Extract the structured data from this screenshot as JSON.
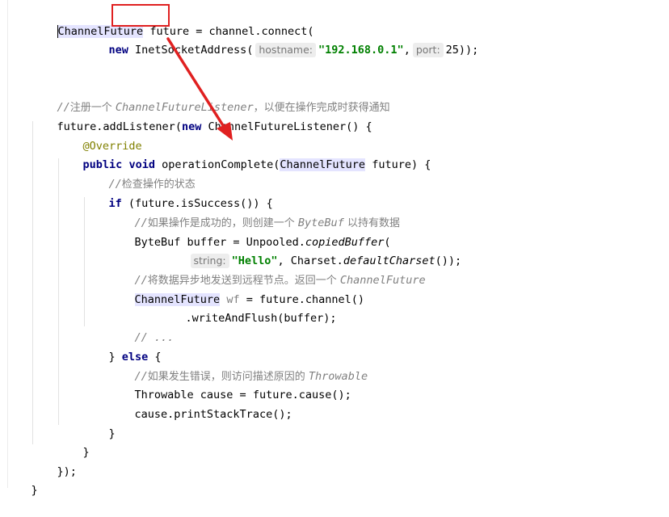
{
  "code": {
    "l1": {
      "type": "ChannelFuture",
      "var": "future",
      "rest": " = channel.connect("
    },
    "l2": {
      "kw_new": "new",
      "cls": "InetSocketAddress(",
      "hint1": "hostname:",
      "str1": "\"192.168.0.1\"",
      "sep": ",",
      "hint2": "port:",
      "rest": "25));"
    },
    "l3": {
      "slashes": "//",
      "zh1": "注册一个 ",
      "cls": "ChannelFutureListener",
      "zh2": "，以便在操作完成时获得通知"
    },
    "l4": {
      "pre": "future.addListener(",
      "kw_new": "new",
      "rest": " ChannelFutureListener() {"
    },
    "l5": {
      "ann": "@Override"
    },
    "l6": {
      "kw_public": "public",
      "kw_void": "void",
      "method": " operationComplete(",
      "type": "ChannelFuture",
      "rest": " future) {"
    },
    "l7": {
      "slashes": "//",
      "zh": "检查操作的状态"
    },
    "l8": {
      "kw_if": "if",
      "rest": " (future.isSuccess()) {"
    },
    "l9": {
      "slashes": "//",
      "zh1": "如果操作是成功的，则创建一个 ",
      "cls": "ByteBuf",
      "zh2": " 以持有数据"
    },
    "l10": {
      "pre": "ByteBuf buffer = Unpooled.",
      "method": "copiedBuffer",
      "rest": "("
    },
    "l11": {
      "hint": "string:",
      "str": "\"Hello\"",
      "mid": ", Charset.",
      "method": "defaultCharset",
      "rest": "());"
    },
    "l12": {
      "slashes": "//",
      "zh": "将数据异步地发送到远程节点。返回一个 ",
      "cls": "ChannelFuture"
    },
    "l13": {
      "type": "ChannelFuture",
      "var": "wf",
      "rest": " = future.channel()"
    },
    "l14": {
      "text": ".writeAndFlush(buffer);"
    },
    "l15": {
      "text": "// ..."
    },
    "l16": {
      "pre": "} ",
      "kw_else": "else",
      "rest": " {"
    },
    "l17": {
      "slashes": "//",
      "zh": "如果发生错误，则访问描述原因的 ",
      "cls": "Throwable"
    },
    "l18": {
      "text": "Throwable cause = future.cause();"
    },
    "l19": {
      "text": "cause.printStackTrace();"
    },
    "l20": {
      "text": "}"
    },
    "l21": {
      "text": "}"
    },
    "l22": {
      "text": "});"
    },
    "l23": {
      "text": "}"
    }
  },
  "annotation": {
    "box_color": "#e02020",
    "arrow_color": "#e02020"
  }
}
